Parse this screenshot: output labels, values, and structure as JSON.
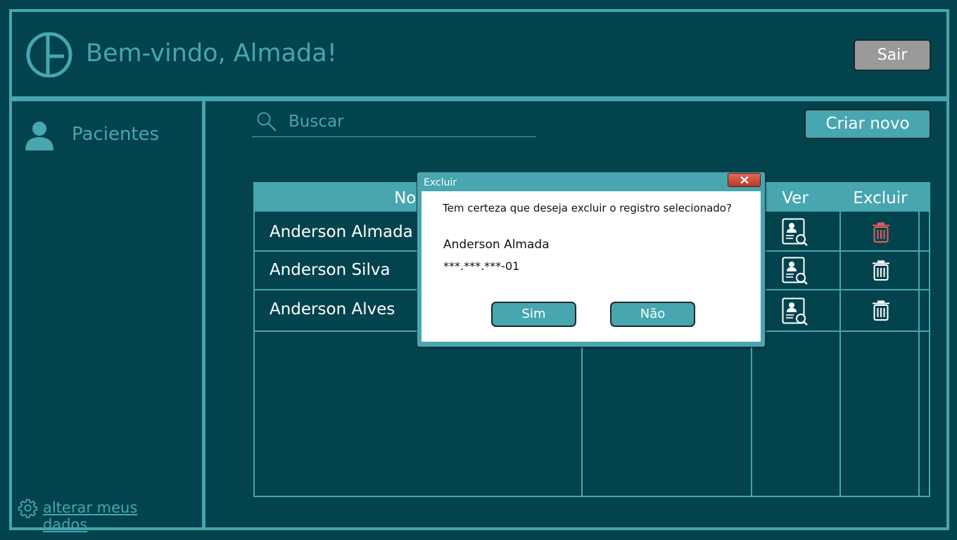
{
  "header": {
    "welcome": "Bem-vindo, Almada!",
    "logout_label": "Sair"
  },
  "sidebar": {
    "items": [
      {
        "label": "Pacientes",
        "icon": "user-icon"
      }
    ],
    "settings_link": "alterar meus dados"
  },
  "search": {
    "placeholder": "Buscar"
  },
  "actions": {
    "create_label": "Criar novo"
  },
  "table": {
    "columns": [
      "Nome",
      "",
      "Ver",
      "Excluir"
    ],
    "rows": [
      {
        "name": "Anderson Almada"
      },
      {
        "name": "Anderson Silva"
      },
      {
        "name": "Anderson Alves"
      }
    ]
  },
  "dialog": {
    "title": "Excluir",
    "question": "Tem certeza que deseja excluir o registro selecionado?",
    "record_name": "Anderson Almada",
    "record_id": "***.***.***-01",
    "confirm_label": "Sim",
    "cancel_label": "Não"
  },
  "colors": {
    "background": "#03434d",
    "accent": "#47a6b0",
    "logout_button": "#9a9a9a",
    "delete_highlight": "#e2605a"
  }
}
